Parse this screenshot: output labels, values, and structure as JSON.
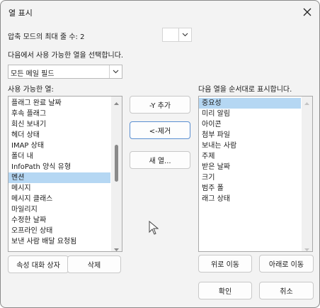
{
  "window": {
    "title": "열 표시",
    "close_icon": "close-icon"
  },
  "compact": {
    "label": "압축 모드의 최대 줄 수:",
    "value": "2"
  },
  "choose": {
    "label": "다음에서 사용 가능한 열을 선택합니다.",
    "selected": "모든 메일 필드"
  },
  "available": {
    "label": "사용 가능한 열:",
    "items": [
      "플래그 완료 날짜",
      "후속 플래그",
      "회신 보내기",
      "헤더 상태",
      "IMAP 상태",
      "폴더 내",
      "InfoPath 양식 유형",
      "멘션",
      "메시지",
      "메시지 클래스",
      "마일리지",
      "수정한 날짜",
      "오프라인 상태",
      "보낸 사람 배달 요청됨"
    ],
    "selected_index": 7
  },
  "actions": {
    "add": "-Y 추가",
    "remove": "<-제거",
    "new_column": "새 열..."
  },
  "shown": {
    "label": "다음 열을 순서대로 표시합니다.",
    "items": [
      "중요성",
      "미리 알림",
      "아이콘",
      "첨부 파일",
      "보내는 사람",
      "주제",
      "받은 날짜",
      "크기",
      "범주 폴",
      "래그 상태"
    ],
    "selected_index": 0
  },
  "bottom": {
    "properties": "속성 대화 상자",
    "delete": "삭제",
    "move_up": "위로 이동",
    "move_down": "아래로 이동",
    "ok": "확인",
    "cancel": "취소"
  },
  "colors": {
    "selection": "#b5d7f3",
    "focus_border": "#5b8fd1"
  }
}
